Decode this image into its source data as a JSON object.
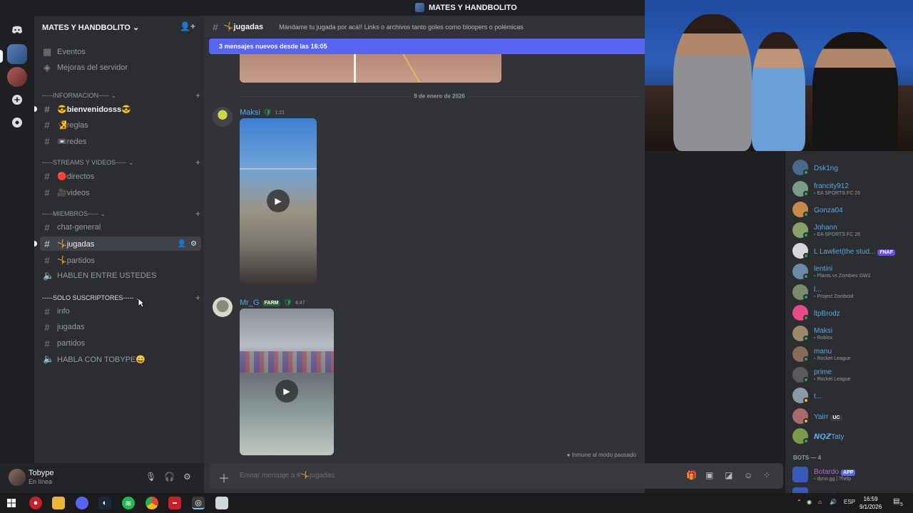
{
  "window": {
    "title": "MATES Y HANDBOLITO"
  },
  "server": {
    "name": "MATES Y HANDBOLITO"
  },
  "sidebar": {
    "top_items": [
      {
        "label": "Eventos",
        "icon": "calendar-icon"
      },
      {
        "label": "Mejoras del servidor",
        "icon": "boost-icon"
      }
    ],
    "categories": [
      {
        "label": "-----INFORMACION-----",
        "channels": [
          {
            "label": "😎bienvenidosss😎",
            "type": "text"
          },
          {
            "label": "🧏reglas",
            "type": "text"
          },
          {
            "label": "📼redes",
            "type": "text"
          }
        ]
      },
      {
        "label": "-----STREAMS Y VIDEOS-----",
        "channels": [
          {
            "label": "🔴directos",
            "type": "text"
          },
          {
            "label": "🎥videos",
            "type": "text"
          }
        ]
      },
      {
        "label": "-----MIEMBROS-----",
        "channels": [
          {
            "label": "chat-general",
            "type": "text"
          },
          {
            "label": "🤸jugadas",
            "type": "text"
          },
          {
            "label": "🤸partidos",
            "type": "text"
          },
          {
            "label": "HABLEN ENTRE USTEDES",
            "type": "voice"
          }
        ]
      },
      {
        "label": "-----SOLO SUSCRIPTORES-----",
        "channels": [
          {
            "label": "info",
            "type": "text"
          },
          {
            "label": "jugadas",
            "type": "text"
          },
          {
            "label": "partidos",
            "type": "text"
          },
          {
            "label": "HABLA CON TOBYPE😄",
            "type": "voice"
          }
        ]
      }
    ]
  },
  "user": {
    "name": "Tobype",
    "status": "En línea"
  },
  "channel": {
    "name": "🤸jugadas",
    "topic": "Mándame tu jugada por acá!! Links o archivos tanto goles como bloopers o polémicas",
    "new_messages": "3 mensajes nuevos desde las 16:05",
    "date_divider": "9 de enero de 2026",
    "messages": [
      {
        "author": "Maksi",
        "time": "1:21",
        "badge": ""
      },
      {
        "author": "Mr_G",
        "time": "4:47",
        "badge": "FARM"
      }
    ],
    "paused_text": "Inmune al modo pausado",
    "composer_placeholder": "Enviar mensaje a #🤸jugadas"
  },
  "members": {
    "list": [
      {
        "name": "Dsk1ng",
        "activity": ""
      },
      {
        "name": "francity912",
        "activity": "EA SPORTS FC 26"
      },
      {
        "name": "Gonza04",
        "activity": ""
      },
      {
        "name": "Johann",
        "activity": "EA SPORTS FC 26"
      },
      {
        "name": "L Lawliet(the stud...",
        "activity": "",
        "tag": "FNAF"
      },
      {
        "name": "lentini",
        "activity": "Plants vs Zombies GW2"
      },
      {
        "name": "l...",
        "activity": "Project Zomboid"
      },
      {
        "name": "ltpBrodz",
        "activity": ""
      },
      {
        "name": "Maksi",
        "activity": "Roblox"
      },
      {
        "name": "manu",
        "activity": "Rocket League"
      },
      {
        "name": "prime",
        "activity": "Rocket League"
      },
      {
        "name": "t...",
        "activity": ""
      },
      {
        "name": "Yairr",
        "activity": "",
        "tag": "UC"
      },
      {
        "name": "𝙉𝙌𝙕Taty",
        "activity": ""
      }
    ],
    "bots_header": "BOTS — 4",
    "bots": [
      {
        "name": "Botardo",
        "sub": "dyno.gg | ?help",
        "tag": "APP"
      },
      {
        "name": "Botardo",
        "sub": "",
        "tag": "APP"
      }
    ]
  },
  "taskbar": {
    "lang": "ESP",
    "time": "16:59",
    "date": "9/1/2026",
    "notif_count": "5"
  }
}
